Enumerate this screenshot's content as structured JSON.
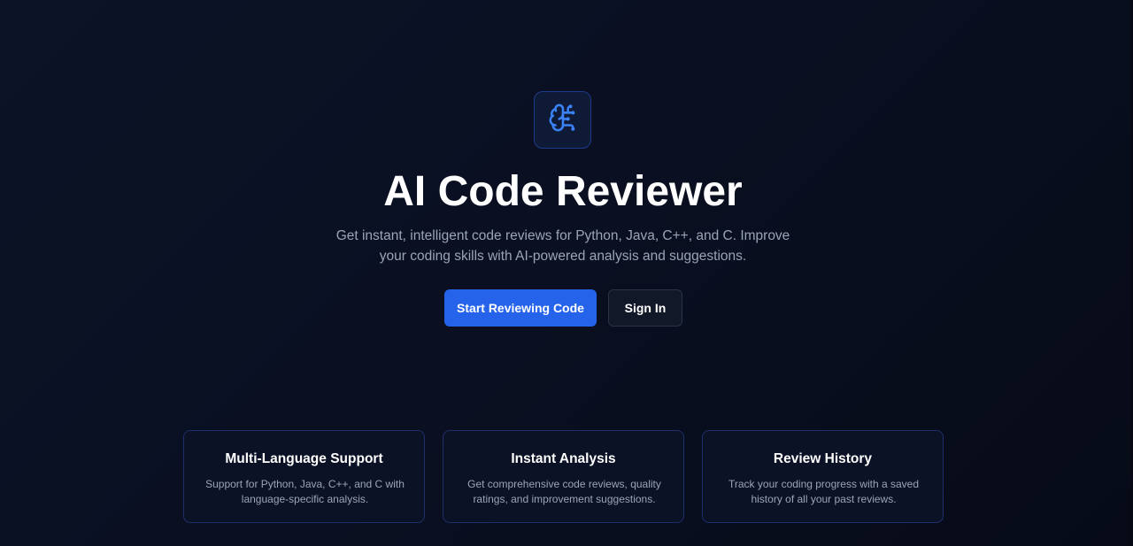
{
  "hero": {
    "logo_icon": "brain-circuit-icon",
    "title": "AI Code Reviewer",
    "subtitle": "Get instant, intelligent code reviews for Python, Java, C++, and C. Improve your coding skills with AI-powered analysis and suggestions.",
    "primary_button": "Start Reviewing Code",
    "secondary_button": "Sign In"
  },
  "features": [
    {
      "title": "Multi-Language Support",
      "description": "Support for Python, Java, C++, and C with language-specific analysis."
    },
    {
      "title": "Instant Analysis",
      "description": "Get comprehensive code reviews, quality ratings, and improvement suggestions."
    },
    {
      "title": "Review History",
      "description": "Track your coding progress with a saved history of all your past reviews."
    }
  ],
  "colors": {
    "accent": "#2563eb",
    "background": "#0a1022",
    "card_border": "#1e2f6b",
    "muted_text": "#9aa4b8"
  }
}
